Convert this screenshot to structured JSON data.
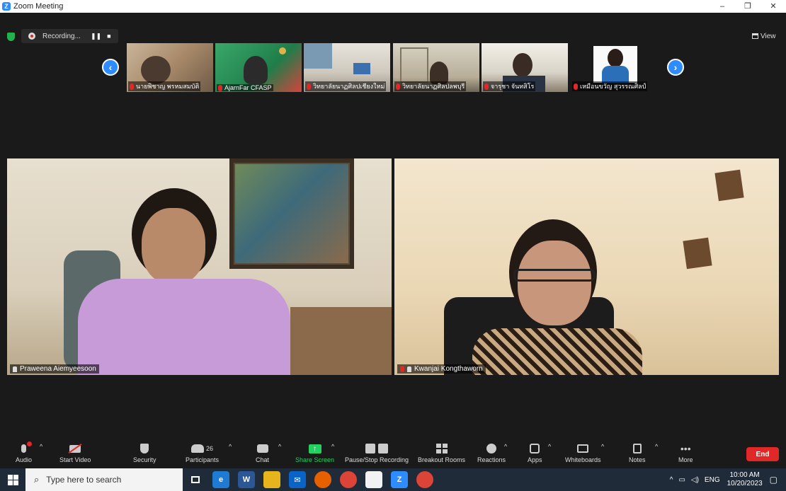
{
  "window": {
    "title": "Zoom Meeting",
    "min": "–",
    "restore": "❐",
    "close": "✕"
  },
  "recording": {
    "label": "Recording...",
    "pause": "❚❚",
    "stop": "■"
  },
  "view": {
    "label": "View"
  },
  "nav": {
    "prev": "‹",
    "next": "›"
  },
  "thumbnails": [
    {
      "name": "นายพิชาญ พรหมสมบัติ"
    },
    {
      "name": "AjarnFar CFASP"
    },
    {
      "name": "วิทยาลัยนาฏศิลปเชียงใหม่"
    },
    {
      "name": "วิทยาลัยนาฏศิลปลพบุรี"
    },
    {
      "name": "จารุชา จันทสิโร"
    },
    {
      "name": "เหมือนขวัญ สุวรรณศิลป์"
    }
  ],
  "tiles": [
    {
      "name": "Praweena Aiemyeesoon"
    },
    {
      "name": "Kwanjai Kongthaworn"
    }
  ],
  "toolbar": {
    "audio": "Audio",
    "start_video": "Start Video",
    "security": "Security",
    "participants": "Participants",
    "participants_count": "26",
    "chat": "Chat",
    "share_screen": "Share Screen",
    "pause_stop_recording": "Pause/Stop Recording",
    "breakout_rooms": "Breakout Rooms",
    "reactions": "Reactions",
    "apps": "Apps",
    "whiteboards": "Whiteboards",
    "notes": "Notes",
    "more": "More",
    "end": "End"
  },
  "taskbar": {
    "search_placeholder": "Type here to search",
    "lang": "ENG",
    "time": "10:00 AM",
    "date": "10/20/2023"
  }
}
